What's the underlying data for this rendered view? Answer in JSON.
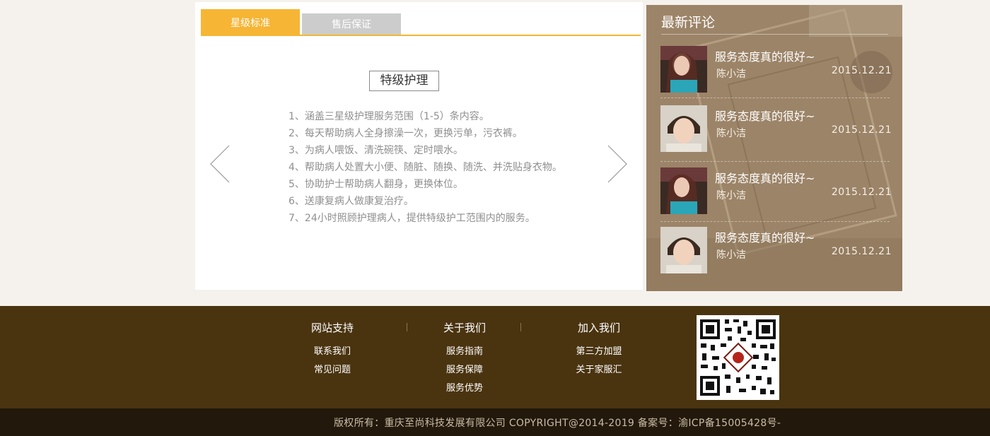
{
  "service": {
    "tabs": [
      {
        "label": "星级标准",
        "active": true
      },
      {
        "label": "售后保证",
        "active": false
      }
    ],
    "level_title": "特级护理",
    "items": [
      "1、涵盖三星级护理服务范围（1-5）条内容。",
      "2、每天帮助病人全身擦澡一次，更换污单，污衣裤。",
      "3、为病人喂饭、清洗碗筷、定时喂水。",
      "4、帮助病人处置大小便、随脏、随换、随洗、并洗贴身衣物。",
      "5、协助护士帮助病人翻身，更换体位。",
      "6、送康复病人做康复治疗。",
      "7、24小时照顾护理病人，提供特级护工范围内的服务。"
    ],
    "arrows": {
      "left_icon": "chevron-left-icon",
      "right_icon": "chevron-right-icon"
    }
  },
  "comments": {
    "title": "最新评论",
    "items": [
      {
        "text": "服务态度真的很好~",
        "author": "陈小洁",
        "date": "2015.12.21",
        "avatar": "avatar-girl-long-hair"
      },
      {
        "text": "服务态度真的很好~",
        "author": "陈小洁",
        "date": "2015.12.21",
        "avatar": "avatar-girl-short-hair"
      },
      {
        "text": "服务态度真的很好~",
        "author": "陈小洁",
        "date": "2015.12.21",
        "avatar": "avatar-girl-long-hair"
      },
      {
        "text": "服务态度真的很好~",
        "author": "陈小洁",
        "date": "2015.12.21",
        "avatar": "avatar-girl-short-hair"
      }
    ]
  },
  "footer": {
    "columns": [
      {
        "heading": "网站支持",
        "links": [
          "联系我们",
          "常见问题"
        ]
      },
      {
        "heading": "关于我们",
        "links": [
          "服务指南",
          "服务保障",
          "服务优势"
        ]
      },
      {
        "heading": "加入我们",
        "links": [
          "第三方加盟",
          "关于家服汇"
        ]
      }
    ],
    "qr_icon": "qr-code-icon",
    "copyright": "版权所有：重庆至尚科技发展有限公司 COPYRIGHT@2014-2019 备案号：渝ICP备15005428号-"
  },
  "colors": {
    "accent": "#f6b534",
    "tab_inactive": "#cccccc",
    "comments_bg": "#9c8468",
    "footer_bg": "#4a3410",
    "copyright_bg": "#22180b"
  }
}
